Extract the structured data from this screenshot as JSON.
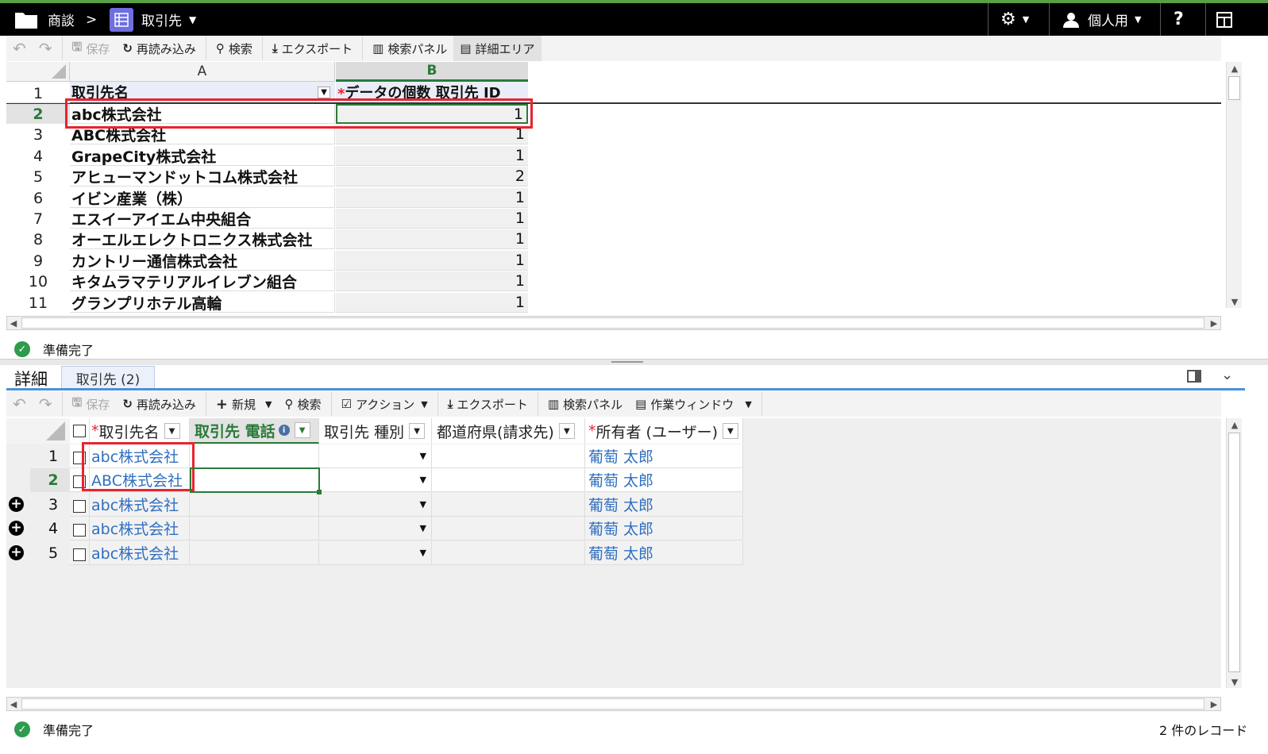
{
  "topbar": {
    "breadcrumb_root": "商談",
    "breadcrumb_sep": ">",
    "breadcrumb_current": "取引先",
    "user_label": "個人用",
    "help_label": "?"
  },
  "toolbar": {
    "undo": "↶",
    "redo": "↷",
    "save": "保存",
    "reload": "再読み込み",
    "search": "検索",
    "export": "エクスポート",
    "search_panel": "検索パネル",
    "detail_area": "詳細エリア"
  },
  "pivot": {
    "col_a": "A",
    "col_b": "B",
    "header_row_num": "1",
    "header_a": "取引先名",
    "header_b_star": "*",
    "header_b": "データの個数 取引先 ID",
    "rows": [
      {
        "num": "2",
        "name": "abc株式会社",
        "count": "1"
      },
      {
        "num": "3",
        "name": "ABC株式会社",
        "count": "1"
      },
      {
        "num": "4",
        "name": "GrapeCity株式会社",
        "count": "1"
      },
      {
        "num": "5",
        "name": "アヒューマンドットコム株式会社",
        "count": "2"
      },
      {
        "num": "6",
        "name": "イビン産業（株）",
        "count": "1"
      },
      {
        "num": "7",
        "name": "エスイーアイエム中央組合",
        "count": "1"
      },
      {
        "num": "8",
        "name": "オーエルエレクトロニクス株式会社",
        "count": "1"
      },
      {
        "num": "9",
        "name": "カントリー通信株式会社",
        "count": "1"
      },
      {
        "num": "10",
        "name": "キタムラマテリアルイレブン組合",
        "count": "1"
      },
      {
        "num": "11",
        "name": "グランプリホテル高輪",
        "count": "1"
      }
    ]
  },
  "status_top": "準備完了",
  "detail": {
    "title": "詳細",
    "tab_label": "取引先 (2)",
    "toolbar": {
      "save": "保存",
      "reload": "再読み込み",
      "new": "新規",
      "search": "検索",
      "action": "アクション",
      "export": "エクスポート",
      "search_panel": "検索パネル",
      "work_window": "作業ウィンドウ"
    },
    "columns": [
      {
        "star": "*",
        "label": "取引先名"
      },
      {
        "star": "",
        "label": "取引先 電話"
      },
      {
        "star": "",
        "label": "取引先 種別"
      },
      {
        "star": "",
        "label": "都道府県(請求先)"
      },
      {
        "star": "*",
        "label": "所有者 (ユーザー)"
      }
    ],
    "rows": [
      {
        "num": "1",
        "name": "abc株式会社",
        "owner": "葡萄 太郎"
      },
      {
        "num": "2",
        "name": "ABC株式会社",
        "owner": "葡萄 太郎"
      },
      {
        "num": "3",
        "name": "abc株式会社",
        "owner": "葡萄 太郎"
      },
      {
        "num": "4",
        "name": "abc株式会社",
        "owner": "葡萄 太郎"
      },
      {
        "num": "5",
        "name": "abc株式会社",
        "owner": "葡萄 太郎"
      }
    ]
  },
  "status_bottom": "準備完了",
  "record_count": "2 件のレコード",
  "colors": {
    "accent_green": "#5a9e46",
    "highlight_red": "#e8242f",
    "link_blue": "#2f6fc0",
    "tab_blue": "#4a90d9"
  }
}
